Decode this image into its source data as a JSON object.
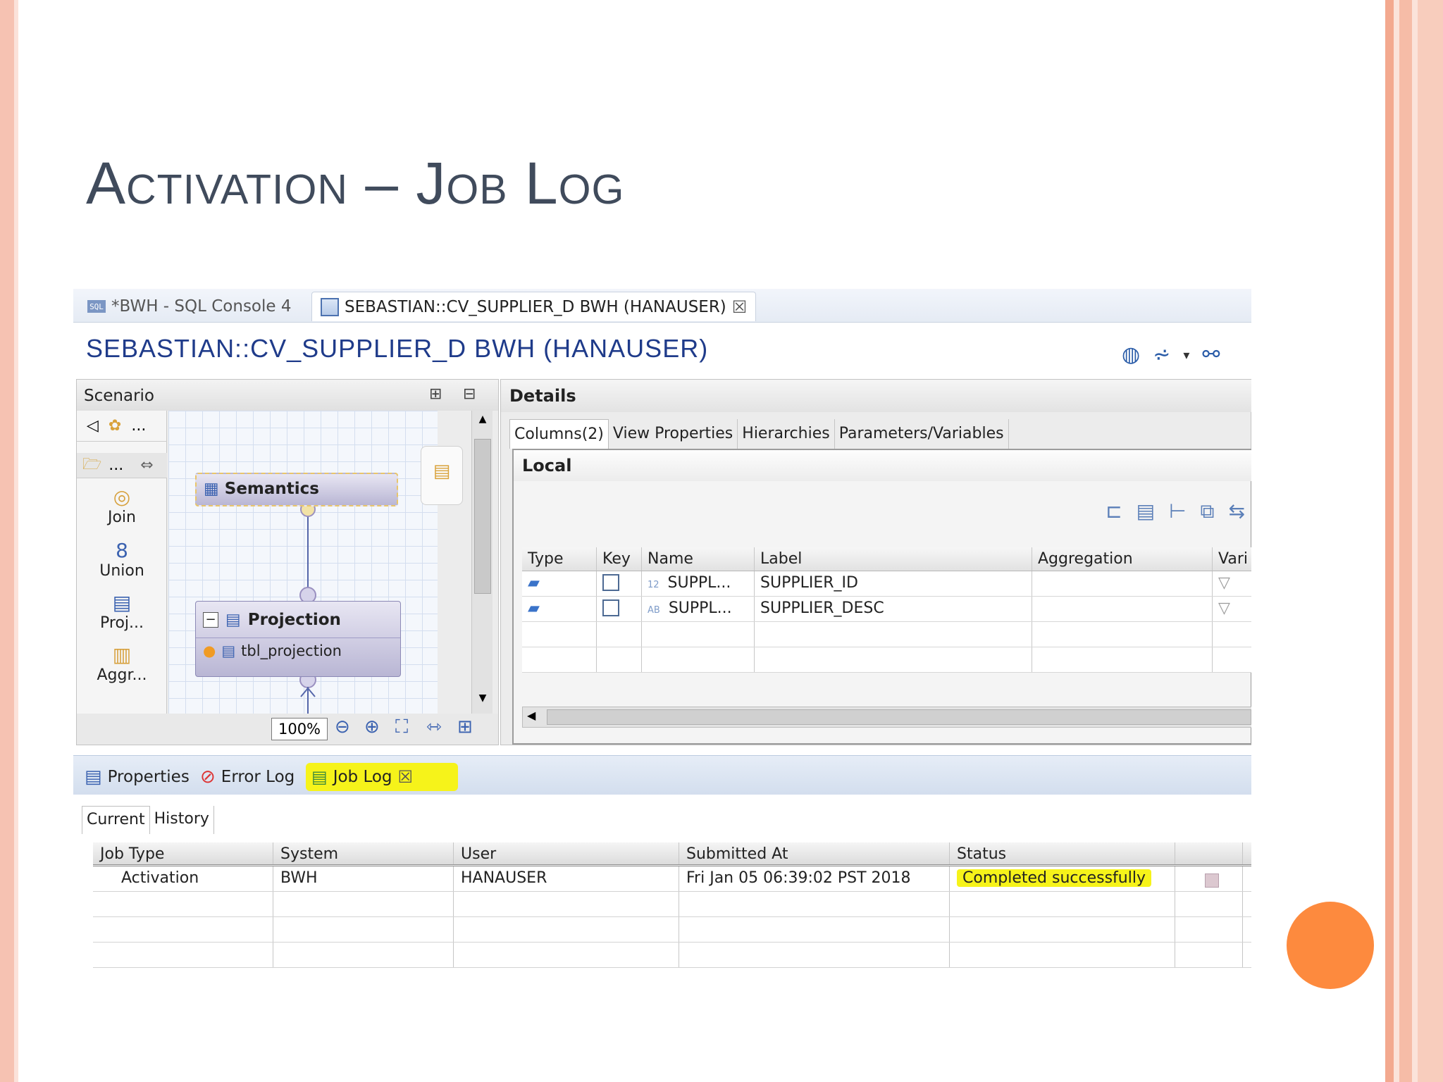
{
  "slide": {
    "title": "Activation – Job Log"
  },
  "editor_tabs": [
    {
      "label": "*BWH - SQL Console 4",
      "icon": "sql-icon"
    },
    {
      "label": "SEBASTIAN::CV_SUPPLIER_D BWH (HANAUSER)",
      "icon": "calc-view-icon"
    }
  ],
  "editor": {
    "title": "SEBASTIAN::CV_SUPPLIER_D BWH (HANAUSER)"
  },
  "scenario": {
    "header": "Scenario",
    "palette": [
      "Join",
      "Union",
      "Proj...",
      "Aggr..."
    ],
    "palette_small": [
      "...",
      "..."
    ],
    "nodes": {
      "semantics": "Semantics",
      "projection": "Projection",
      "projection_source": "tbl_projection"
    },
    "zoom": "100%"
  },
  "details": {
    "header": "Details",
    "tabs": [
      "Columns(2)",
      "View Properties",
      "Hierarchies",
      "Parameters/Variables"
    ],
    "section": "Local",
    "columns": [
      "Type",
      "Key",
      "Name",
      "Label",
      "Aggregation",
      "Vari"
    ],
    "rows": [
      {
        "type_tag": "12",
        "name": "SUPPL...",
        "label": "SUPPLIER_ID"
      },
      {
        "type_tag": "AB",
        "name": "SUPPL...",
        "label": "SUPPLIER_DESC"
      }
    ]
  },
  "bottom_tabs": [
    "Properties",
    "Error Log",
    "Job Log"
  ],
  "job_log": {
    "subtabs": [
      "Current",
      "History"
    ],
    "columns": [
      "Job Type",
      "System",
      "User",
      "Submitted At",
      "Status"
    ],
    "rows": [
      {
        "job_type": "Activation",
        "system": "BWH",
        "user": "HANAUSER",
        "submitted_at": "Fri Jan 05 06:39:02 PST 2018",
        "status": "Completed successfully"
      }
    ]
  },
  "colors": {
    "highlight": "#f6f31a",
    "accent_orange": "#fd8a3e",
    "title_text": "#404b5c",
    "editor_title": "#1f3b8a"
  }
}
